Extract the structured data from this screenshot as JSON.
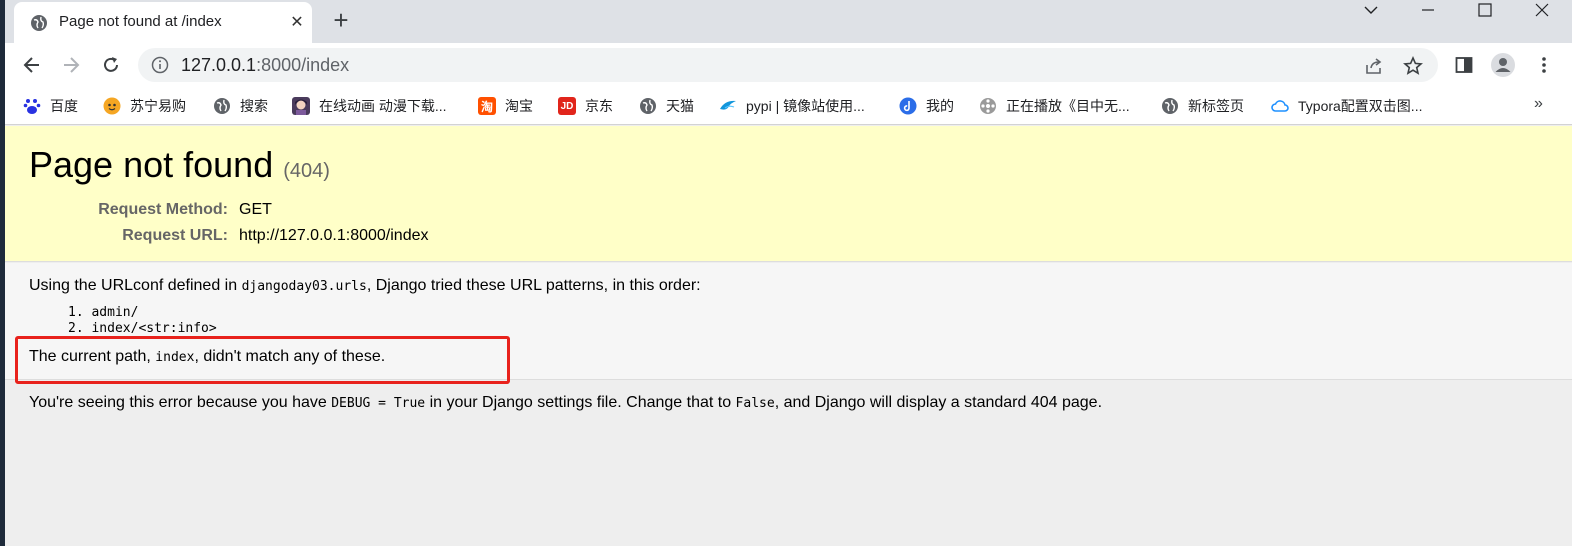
{
  "browser": {
    "tab": {
      "title": "Page not found at /index",
      "close_symbol": "✕"
    },
    "new_tab_symbol": "+",
    "address": {
      "host": "127.0.0.1",
      "rest": ":8000/index"
    },
    "bookmarks": [
      {
        "label": "百度",
        "icon": "baidu-icon",
        "color": "#2932e1"
      },
      {
        "label": "苏宁易购",
        "icon": "suning-icon",
        "color": "#f5a623"
      },
      {
        "label": "搜索",
        "icon": "globe-icon",
        "color": "#5f6368"
      },
      {
        "label": "在线动画 动漫下载...",
        "icon": "anime-avatar-icon",
        "color": "#4a3b5c"
      },
      {
        "label": "淘宝",
        "icon": "taobao-icon",
        "color": "#ff5000"
      },
      {
        "label": "京东",
        "icon": "jd-icon",
        "color": "#e1251b"
      },
      {
        "label": "天猫",
        "icon": "globe-icon",
        "color": "#5f6368"
      },
      {
        "label": "pypi | 镜像站使用...",
        "icon": "bird-icon",
        "color": "#1296db"
      },
      {
        "label": "我的",
        "icon": "music-icon",
        "color": "#2b6de8"
      },
      {
        "label": "正在播放《目中无...",
        "icon": "film-icon",
        "color": "#888888"
      },
      {
        "label": "新标签页",
        "icon": "globe-icon",
        "color": "#5f6368"
      },
      {
        "label": "Typora配置双击图...",
        "icon": "cloud-icon",
        "color": "#1e90ff"
      }
    ],
    "bookmarks_more": "»"
  },
  "page": {
    "title": "Page not found",
    "status": "(404)",
    "request_method_label": "Request Method:",
    "request_method": "GET",
    "request_url_label": "Request URL:",
    "request_url": "http://127.0.0.1:8000/index",
    "urlconf_prefix": "Using the URLconf defined in ",
    "urlconf_module": "djangoday03.urls",
    "urlconf_suffix": ", Django tried these URL patterns, in this order:",
    "patterns": [
      "1.  admin/",
      "2.  index/<str:info>"
    ],
    "nomatch_prefix": "The current path, ",
    "nomatch_path": "index",
    "nomatch_suffix": ", didn't match any of these.",
    "explanation_prefix": "You're seeing this error because you have ",
    "explanation_code1": "DEBUG = True",
    "explanation_mid": " in your Django settings file. Change that to ",
    "explanation_code2": "False",
    "explanation_suffix": ", and Django will display a standard 404 page."
  }
}
